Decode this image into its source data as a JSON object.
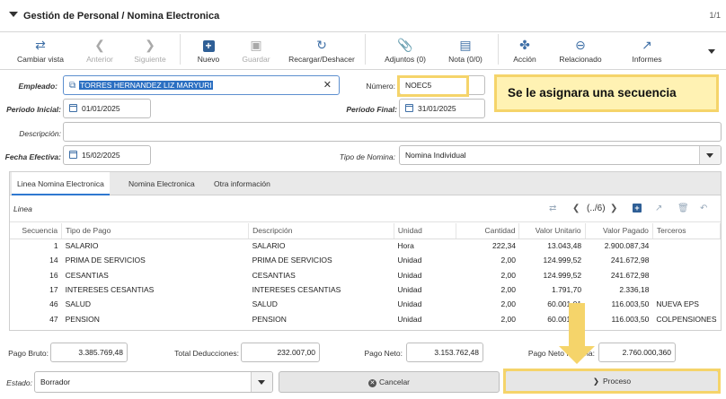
{
  "window": {
    "title": "Gestión de Personal / Nomina Electronica",
    "page_count": "1/1"
  },
  "toolbar": {
    "cambiar_vista": "Cambiar vista",
    "anterior": "Anterior",
    "siguiente": "Siguiente",
    "nuevo": "Nuevo",
    "guardar": "Guardar",
    "recargar": "Recargar/Deshacer",
    "adjuntos": "Adjuntos (0)",
    "nota": "Nota (0/0)",
    "accion": "Acción",
    "relacionado": "Relacionado",
    "informes": "Informes"
  },
  "form": {
    "empleado_label": "Empleado:",
    "empleado_value": "TORRES HERNANDEZ LIZ MARYURI",
    "numero_label": "Número:",
    "numero_value": "NOEC5",
    "periodo_inicial_label": "Período Inicial:",
    "periodo_inicial_value": "01/01/2025",
    "periodo_final_label": "Período Final:",
    "periodo_final_value": "31/01/2025",
    "descripcion_label": "Descripción:",
    "descripcion_value": "",
    "fecha_efectiva_label": "Fecha Efectiva:",
    "fecha_efectiva_value": "15/02/2025",
    "tipo_nomina_label": "Tipo de Nomina:",
    "tipo_nomina_value": "Nomina Individual"
  },
  "callout": "Se le asignara una secuencia",
  "tabs": [
    "Linea Nomina Electronica",
    "Nomina Electronica",
    "Otra información"
  ],
  "grid": {
    "title": "Linea",
    "pager": "(../6)",
    "columns": [
      "Secuencia",
      "Tipo de Pago",
      "Descripción",
      "Unidad",
      "Cantidad",
      "Valor Unitario",
      "Valor Pagado",
      "Terceros"
    ],
    "rows": [
      [
        "1",
        "SALARIO",
        "SALARIO",
        "Hora",
        "222,34",
        "13.043,48",
        "2.900.087,34",
        ""
      ],
      [
        "14",
        "PRIMA DE SERVICIOS",
        "PRIMA DE SERVICIOS",
        "Unidad",
        "2,00",
        "124.999,52",
        "241.672,98",
        ""
      ],
      [
        "16",
        "CESANTIAS",
        "CESANTIAS",
        "Unidad",
        "2,00",
        "124.999,52",
        "241.672,98",
        ""
      ],
      [
        "17",
        "INTERESES CESANTIAS",
        "INTERESES CESANTIAS",
        "Unidad",
        "2,00",
        "1.791,70",
        "2.336,18",
        ""
      ],
      [
        "46",
        "SALUD",
        "SALUD",
        "Unidad",
        "2,00",
        "60.001,01",
        "116.003,50",
        "NUEVA EPS"
      ],
      [
        "47",
        "PENSION",
        "PENSION",
        "Unidad",
        "2,00",
        "60.001,01",
        "116.003,50",
        "COLPENSIONES"
      ]
    ]
  },
  "totals": {
    "pago_bruto_label": "Pago Bruto:",
    "pago_bruto_value": "3.385.769,48",
    "total_deducciones_label": "Total Deducciones:",
    "total_deducciones_value": "232.007,00",
    "pago_neto_label": "Pago Neto:",
    "pago_neto_value": "3.153.762,48",
    "pago_neto_nomina_label": "Pago Neto Nómina:",
    "pago_neto_nomina_value": "2.760.000,360"
  },
  "footer": {
    "estado_label": "Estado:",
    "estado_value": "Borrador",
    "cancelar": "Cancelar",
    "proceso": "Proceso"
  },
  "colors": {
    "accent": "#3e6fa6",
    "highlight": "#f5d46a",
    "callout_bg": "#fff2b3",
    "selection": "#2b6fc2"
  }
}
